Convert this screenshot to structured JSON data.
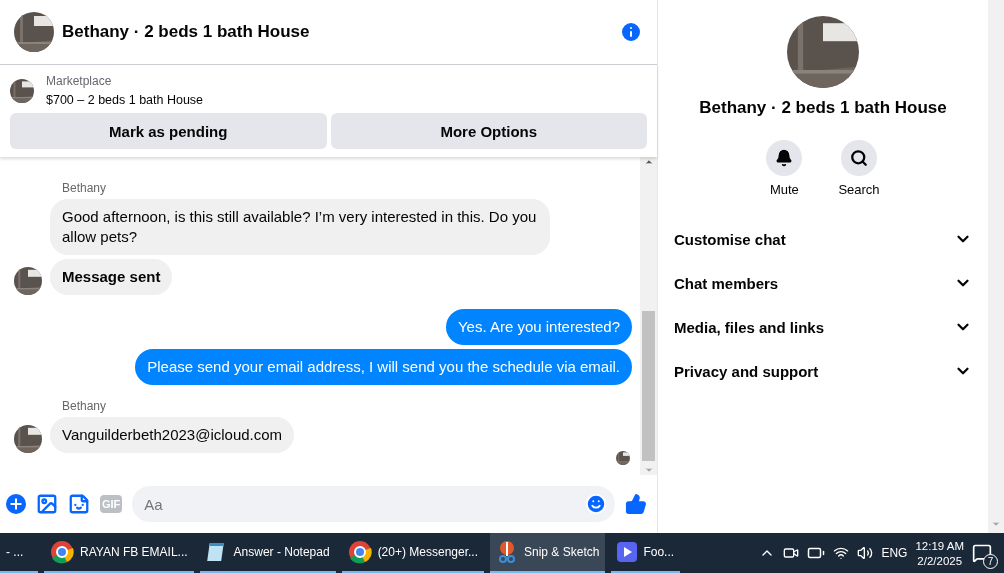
{
  "header": {
    "title": "Bethany · 2 beds 1 bath House"
  },
  "listing": {
    "label": "Marketplace",
    "title": "$700 – 2 beds 1 bath House"
  },
  "actions": [
    "Mark as pending",
    "More Options"
  ],
  "groups": [
    {
      "kind": "incoming",
      "sender": "Bethany",
      "messages": [
        {
          "kind": "text",
          "text": "Good afternoon, is this still available? I’m very interested in this. Do you allow pets?"
        },
        {
          "kind": "status",
          "text": "Message sent"
        }
      ]
    },
    {
      "kind": "outgoing",
      "messages": [
        {
          "kind": "text",
          "text": "Yes. Are you interested?"
        },
        {
          "kind": "text",
          "text": "Please send your email address, I will send you the schedule via email."
        }
      ]
    },
    {
      "kind": "incoming",
      "sender": "Bethany",
      "messages": [
        {
          "kind": "text",
          "text": "Vanguilderbeth2023@icloud.com"
        }
      ]
    }
  ],
  "composer": {
    "gif": "GIF",
    "placeholder": "Aa"
  },
  "side": {
    "title": "Bethany · 2 beds 1 bath House",
    "actions": [
      {
        "kind": "bell",
        "label": "Mute"
      },
      {
        "kind": "search",
        "label": "Search"
      }
    ],
    "sections": [
      {
        "label": "Customise chat",
        "expanded": false
      },
      {
        "label": "Chat members",
        "expanded": false
      },
      {
        "label": "Media, files and links",
        "expanded": false
      },
      {
        "label": "Privacy and support",
        "expanded": false
      }
    ]
  },
  "taskbar": {
    "items": [
      {
        "kind": "cut",
        "label": "- ...",
        "selected": false
      },
      {
        "kind": "chrome",
        "label": "RAYAN FB EMAIL...",
        "selected": false
      },
      {
        "kind": "notepad",
        "label": "Answer - Notepad",
        "selected": false
      },
      {
        "kind": "chrome",
        "label": "(20+) Messenger...",
        "selected": false
      },
      {
        "kind": "snip",
        "label": "Snip & Sketch",
        "selected": true
      },
      {
        "kind": "player",
        "label": "Foo...",
        "selected": false
      }
    ],
    "language": "ENG",
    "time": "12:19 AM",
    "date": "2/2/2025",
    "notifications": "7"
  }
}
